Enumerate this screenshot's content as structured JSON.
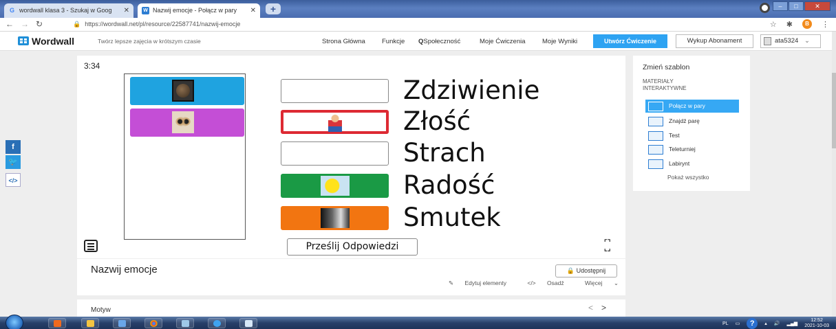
{
  "browser": {
    "tabs": [
      {
        "label": "wordwall klasa 3 - Szukaj w Goog",
        "icon": "G"
      },
      {
        "label": "Nazwij emocje - Połącz w pary",
        "icon": "W"
      }
    ],
    "url": "https://wordwall.net/pl/resource/22587741/nazwij-emocje",
    "extension_badge": "B"
  },
  "header": {
    "logo": "Wordwall",
    "tagline": "Twórz lepsze zajęcia w krótszym czasie",
    "nav": [
      "Strona Główna",
      "Funkcje",
      "Społeczność",
      "Moje Ćwiczenia",
      "Moje Wyniki"
    ],
    "create_label": "Utwórz Ćwiczenie",
    "subscribe_label": "Wykup Abonament",
    "username": "ata5324"
  },
  "activity": {
    "timer": "3:34",
    "words": [
      "Zdziwienie",
      "Złość",
      "Strach",
      "Radość",
      "Smutek"
    ],
    "submit_label": "Prześlij Odpowiedzi",
    "colors": {
      "tile1": "#1fa3e0",
      "tile2": "#c44ed6",
      "wrong": "#dd2a33",
      "green": "#1a9a45",
      "orange": "#f27511"
    }
  },
  "title_card": {
    "title": "Nazwij emocje",
    "share_label": "Udostępnij",
    "edit_label": "Edytuj elementy",
    "embed_label": "Osadź",
    "more_label": "Więcej"
  },
  "motyw": {
    "label": "Motyw"
  },
  "side_panel": {
    "title": "Zmień szablon",
    "section_line1": "MATERIAŁY",
    "section_line2": "INTERAKTYWNE",
    "items": [
      "Połącz w pary",
      "Znajdź parę",
      "Test",
      "Teleturniej",
      "Labirynt"
    ],
    "show_all": "Pokaż wszystko"
  },
  "social": {
    "facebook": "f",
    "twitter": "t",
    "embed": "</>"
  },
  "taskbar": {
    "lang": "PL",
    "time": "12:52",
    "date": "2021-10-03"
  }
}
